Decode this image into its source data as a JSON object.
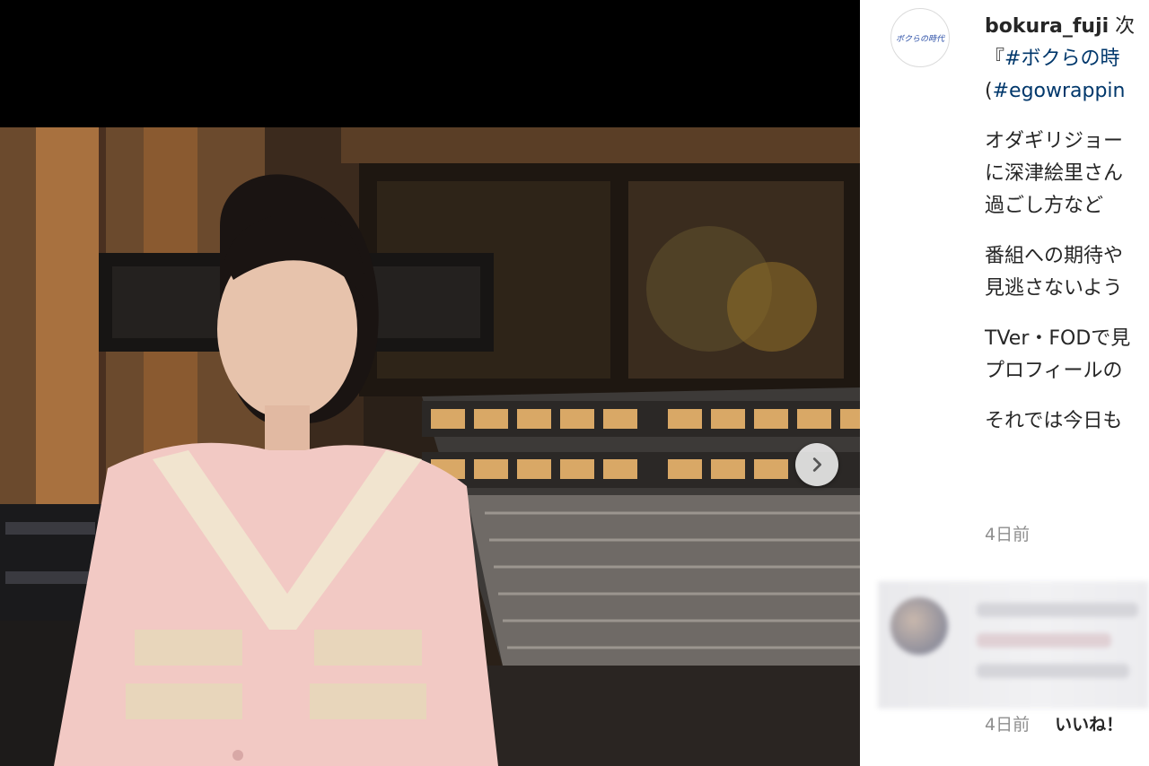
{
  "post": {
    "username": "bokura_fuji",
    "avatar_text": "ボクらの時代",
    "caption_lines": [
      {
        "prefix": "",
        "text": "次",
        "tag": ""
      },
      {
        "prefix": "『",
        "text": "",
        "tag": "#ボクらの時"
      },
      {
        "prefix": "(",
        "text": "",
        "tag": "#egowrappin"
      }
    ],
    "body_paragraphs": [
      [
        "オダギリジョー",
        "に深津絵里さん",
        "過ごし方など"
      ],
      [
        "番組への期待や",
        "見逃さないよう"
      ],
      [
        "TVer・FODで見",
        "プロフィールの"
      ],
      [
        "それでは今日も"
      ]
    ],
    "timestamp": "4日前"
  },
  "comment": {
    "timestamp": "4日前",
    "like_label": "いいね！"
  },
  "media": {
    "next_icon": "chevron-right-icon"
  }
}
